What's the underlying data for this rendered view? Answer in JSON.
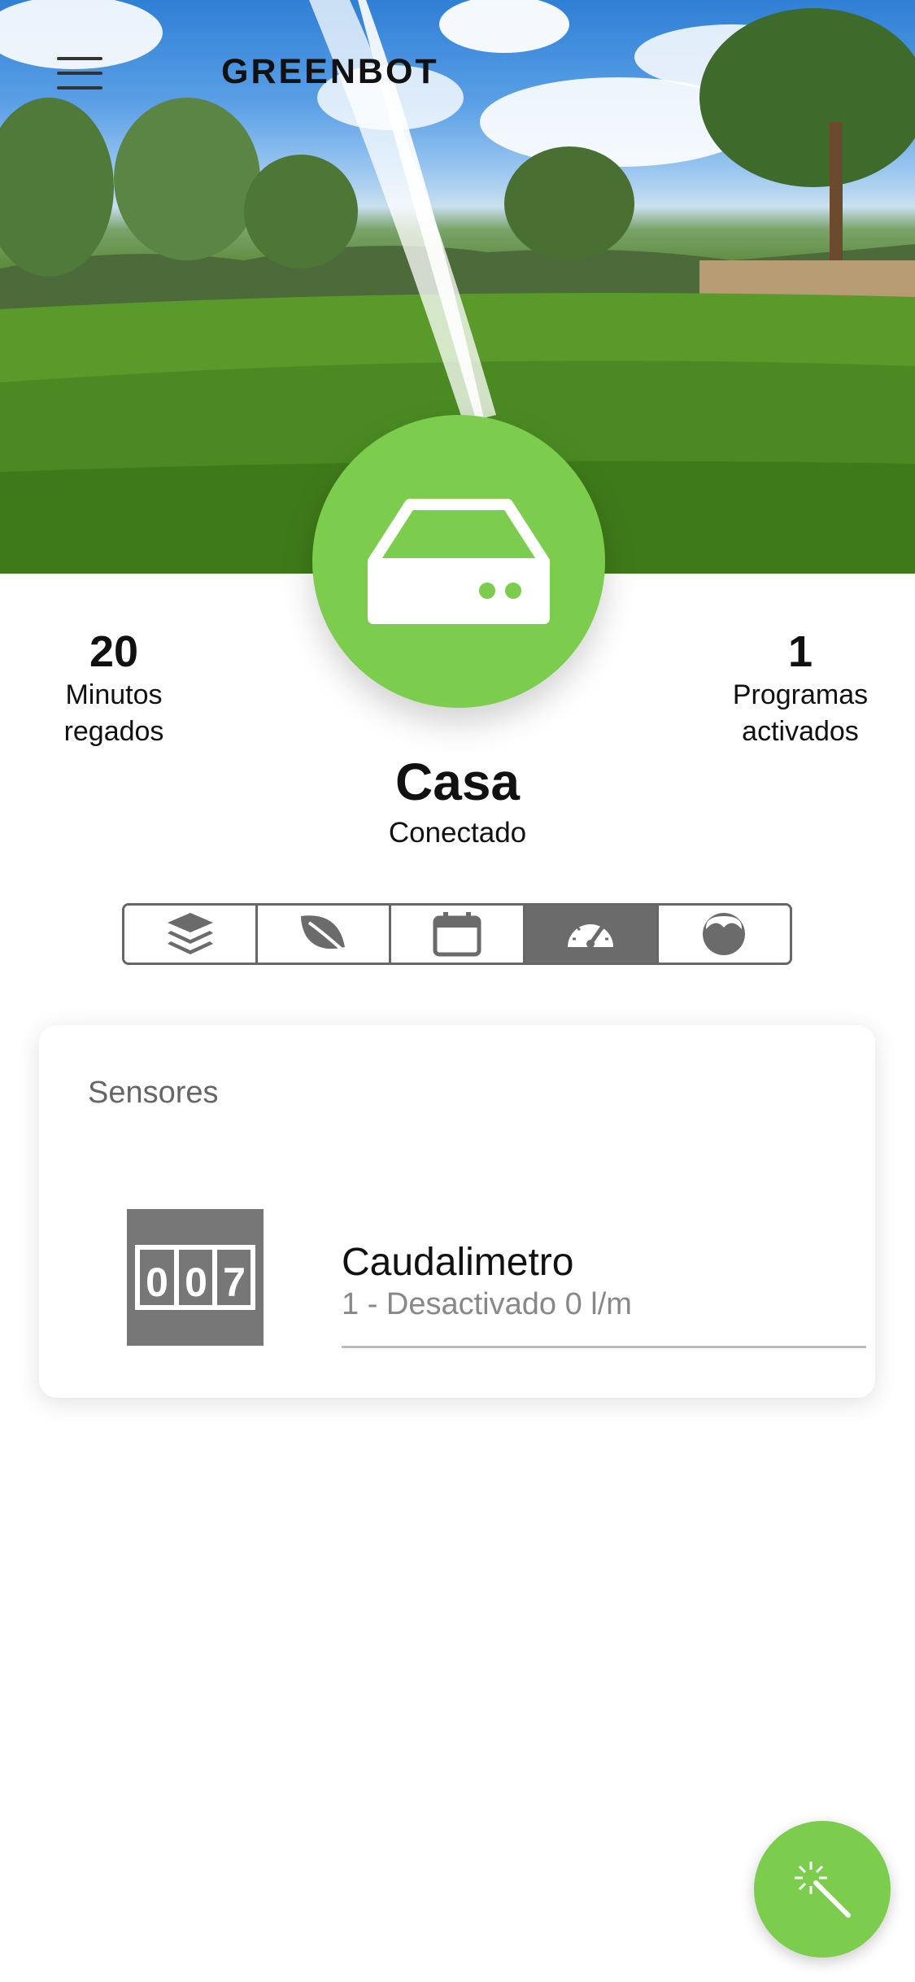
{
  "app": {
    "title": "GREENBOT"
  },
  "header": {
    "menu_icon": "hamburger-menu-icon",
    "background": "sprinkler-lawn-photo"
  },
  "device": {
    "name": "Casa",
    "status": "Conectado",
    "icon": "controller-box-icon",
    "accent": "#7ccd4e"
  },
  "stats": {
    "left": {
      "value": "20",
      "line1": "Minutos",
      "line2": "regados"
    },
    "right": {
      "value": "1",
      "line1": "Programas",
      "line2": "activados"
    }
  },
  "tabs": [
    {
      "icon": "layers-icon",
      "active": false
    },
    {
      "icon": "leaf-icon",
      "active": false
    },
    {
      "icon": "calendar-icon",
      "active": false
    },
    {
      "icon": "speedometer-icon",
      "active": true
    },
    {
      "icon": "gauge-half-icon",
      "active": false
    }
  ],
  "sensors": {
    "title": "Sensores",
    "items": [
      {
        "name": "Caudalimetro",
        "detail": "1 - Desactivado 0 l/m",
        "counter_digits": [
          "0",
          "0",
          "7"
        ],
        "icon": "flow-meter-counter-icon"
      }
    ]
  },
  "fab": {
    "icon": "magic-wand-icon"
  },
  "colors": {
    "green": "#7ccd4e",
    "tab_active": "#6b6b6b",
    "border": "#666666"
  }
}
